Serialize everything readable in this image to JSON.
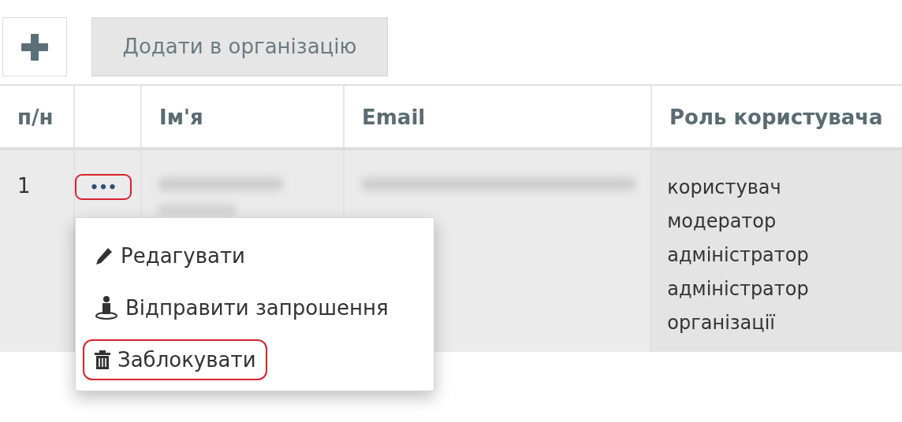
{
  "toolbar": {
    "add_icon_button": {
      "kind": "plus"
    },
    "add_to_org_button": {
      "label": "Додати в організацію"
    }
  },
  "table": {
    "columns": [
      "п/н",
      "",
      "Ім'я",
      "Email",
      "Роль користувача"
    ],
    "rows": [
      {
        "number": "1",
        "actions_button": {
          "label": "•••",
          "highlighted": true
        },
        "name": {
          "kind": "blurred"
        },
        "email": {
          "kind": "blurred"
        },
        "roles": [
          "користувач",
          "модератор",
          "адміністратор",
          "адміністратор організації"
        ]
      }
    ]
  },
  "action_menu": {
    "items": [
      {
        "kind": "edit",
        "label": "Редагувати",
        "highlighted": false
      },
      {
        "kind": "invite",
        "label": "Відправити запрошення",
        "highlighted": false
      },
      {
        "kind": "block",
        "label": "Заблокувати",
        "highlighted": true
      }
    ]
  }
}
